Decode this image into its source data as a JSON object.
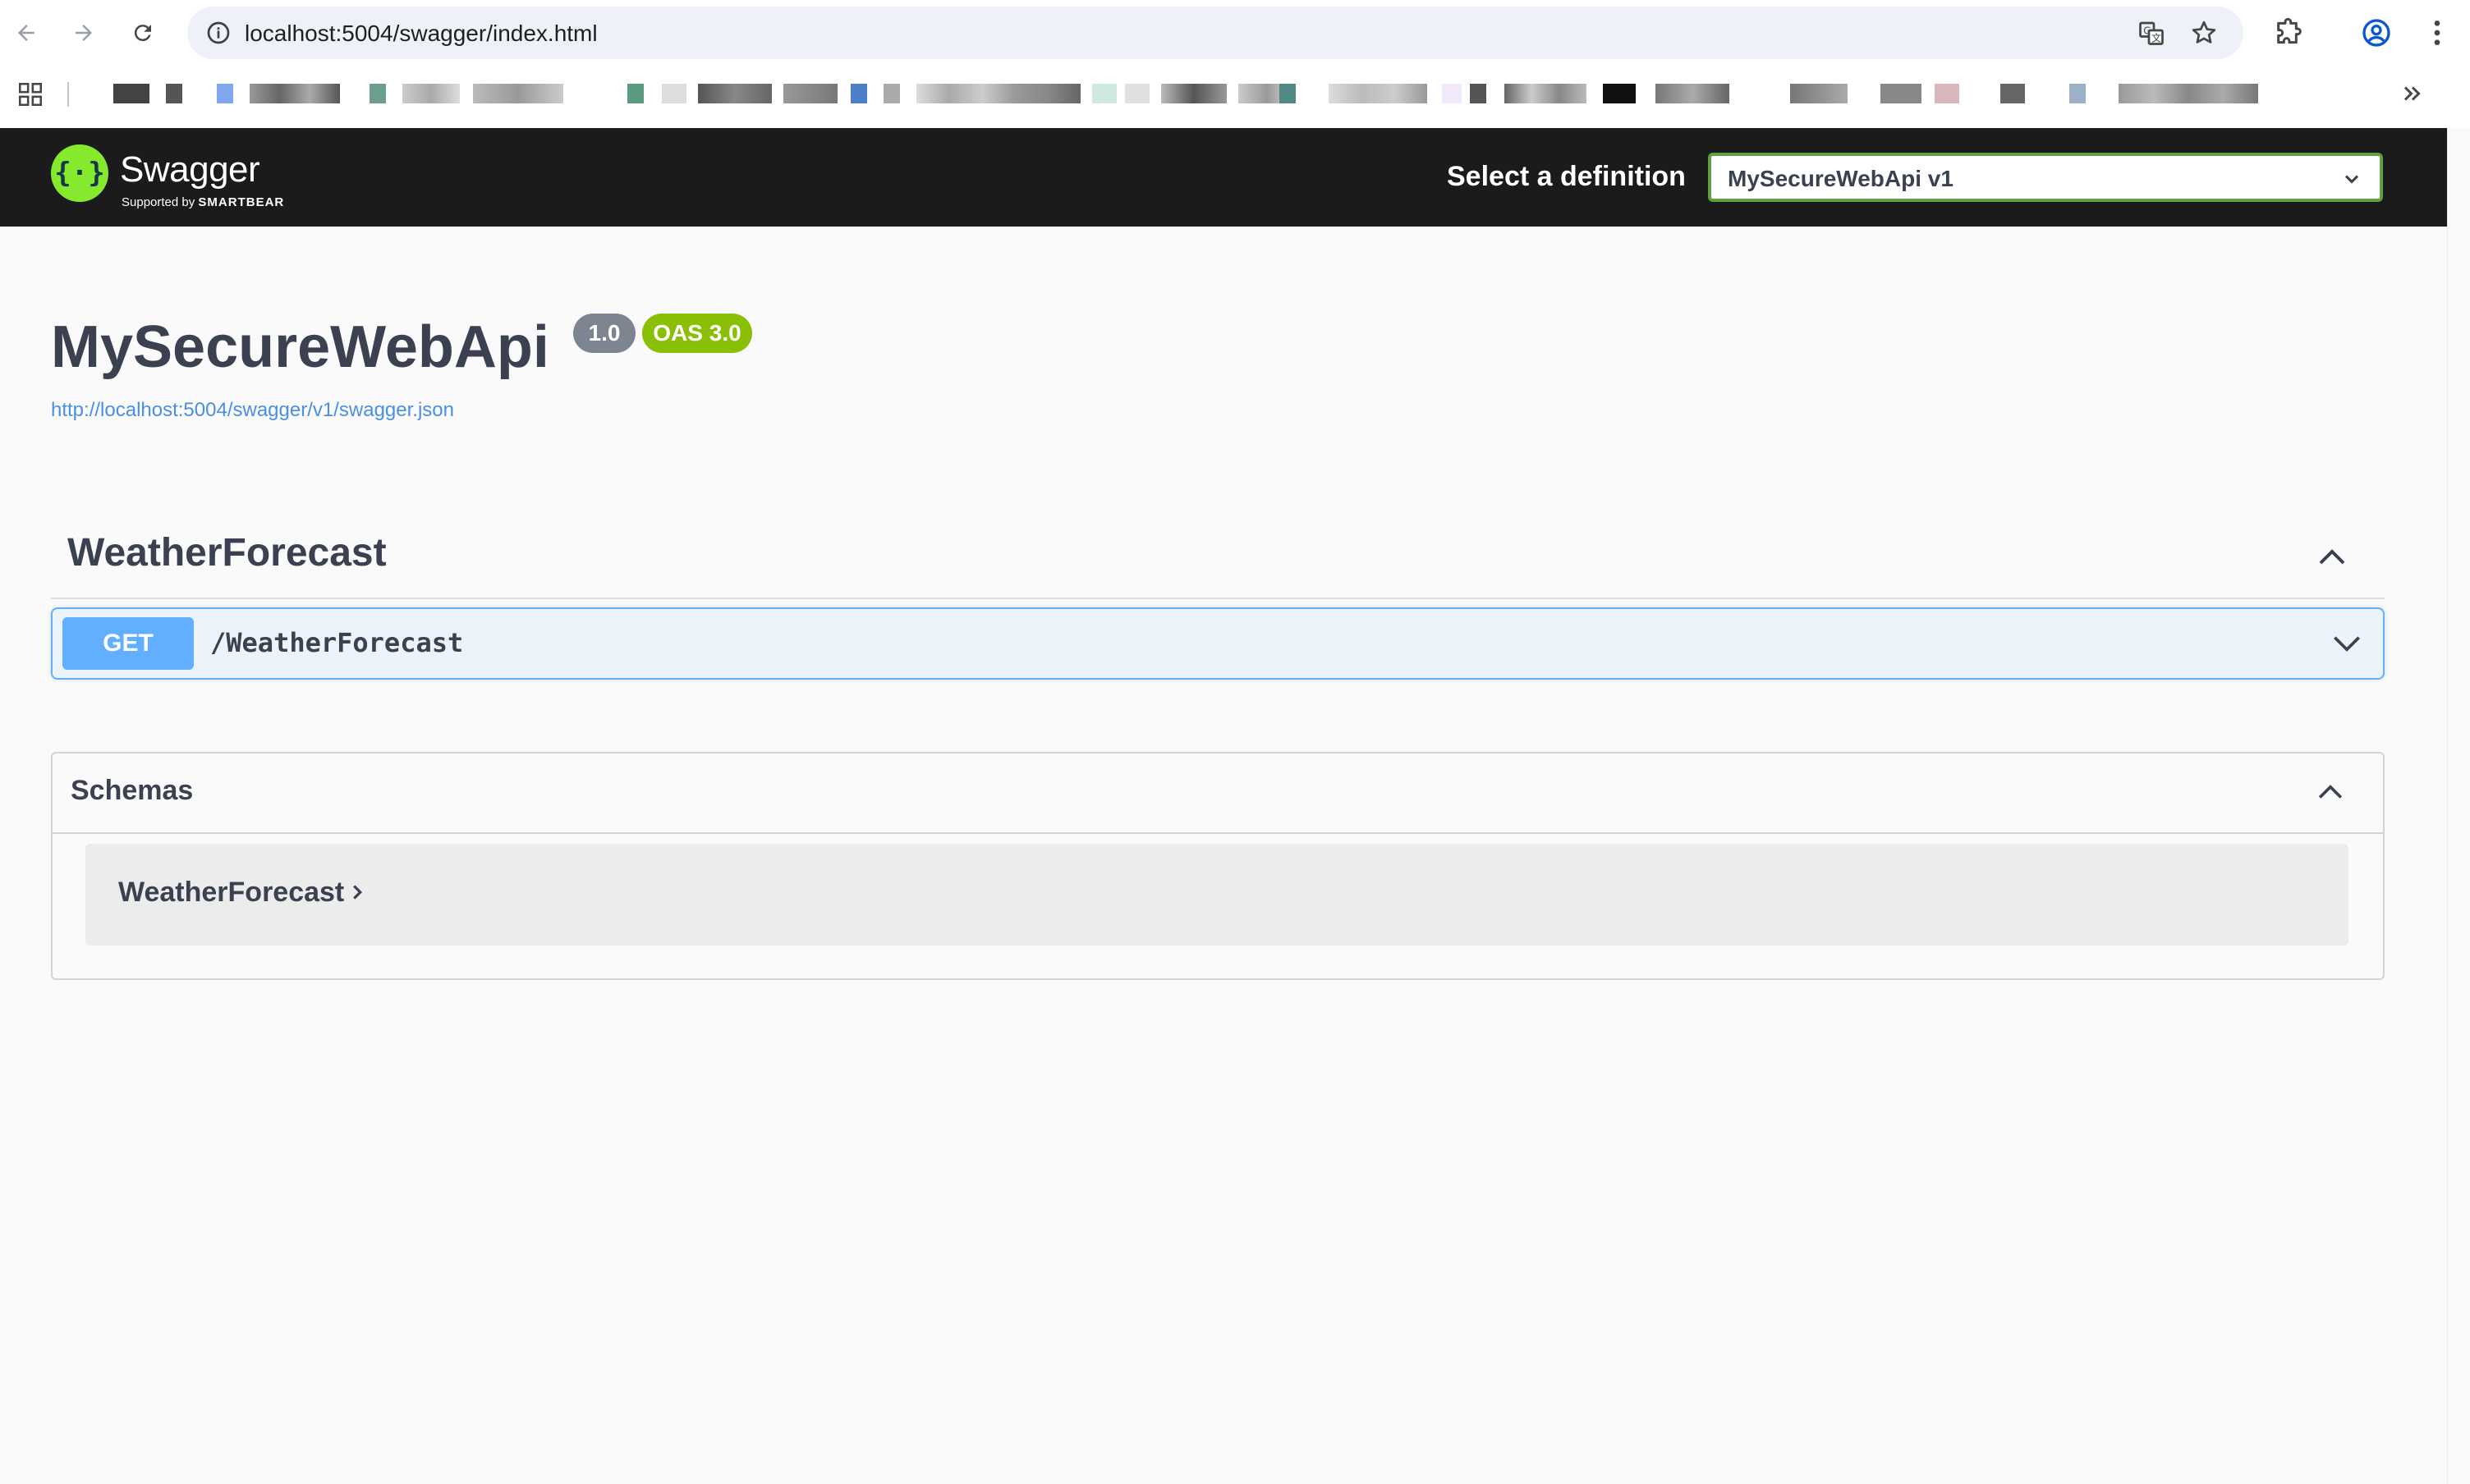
{
  "browser": {
    "url": "localhost:5004/swagger/index.html",
    "icons": [
      "back-icon",
      "forward-icon",
      "reload-icon",
      "site-info-icon",
      "translate-icon",
      "bookmark-star-icon",
      "extensions-icon",
      "profile-icon",
      "menu-kebab-icon",
      "apps-grid-icon",
      "more-bookmarks-icon"
    ]
  },
  "topbar": {
    "logo_text": "Swagger",
    "logo_sub_prefix": "Supported by",
    "logo_sub_brand": "SMARTBEAR",
    "definition_label": "Select a definition",
    "definition_selected": "MySecureWebApi v1"
  },
  "info": {
    "title": "MySecureWebApi",
    "version": "1.0",
    "oas": "OAS 3.0",
    "spec_url": "http://localhost:5004/swagger/v1/swagger.json"
  },
  "operations": {
    "tag": "WeatherForecast",
    "items": [
      {
        "method": "GET",
        "path": "/WeatherForecast"
      }
    ]
  },
  "schemas": {
    "title": "Schemas",
    "models": [
      "WeatherForecast"
    ]
  },
  "colors": {
    "topbar_bg": "#1b1b1b",
    "swagger_green": "#85ea2d",
    "select_border": "#62a03f",
    "get_blue": "#61affe",
    "get_bg": "#ebf3fb",
    "oas_badge": "#89bf04",
    "version_badge": "#7d8492",
    "link": "#4990e2"
  }
}
